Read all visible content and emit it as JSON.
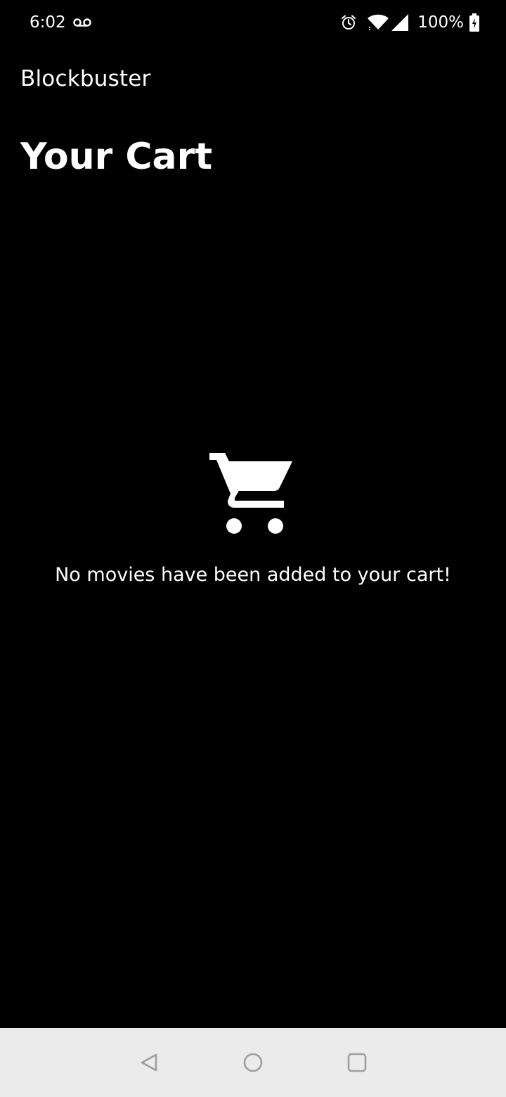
{
  "status_bar": {
    "time": "6:02",
    "battery_percent": "100%",
    "icons": [
      "voicemail-icon",
      "alarm-icon",
      "wifi-icon",
      "signal-icon",
      "battery-charging-icon"
    ]
  },
  "app_bar": {
    "title": "Blockbuster"
  },
  "page": {
    "title": "Your Cart"
  },
  "empty_state": {
    "icon": "shopping-cart-icon",
    "message": "No movies have been added to your cart!"
  },
  "nav_bar": {
    "buttons": [
      "back-icon",
      "home-icon",
      "recents-icon"
    ]
  },
  "colors": {
    "background": "#000000",
    "text": "#ffffff",
    "nav_bar_background": "#ebebeb",
    "nav_icon": "#9e9e9e"
  }
}
